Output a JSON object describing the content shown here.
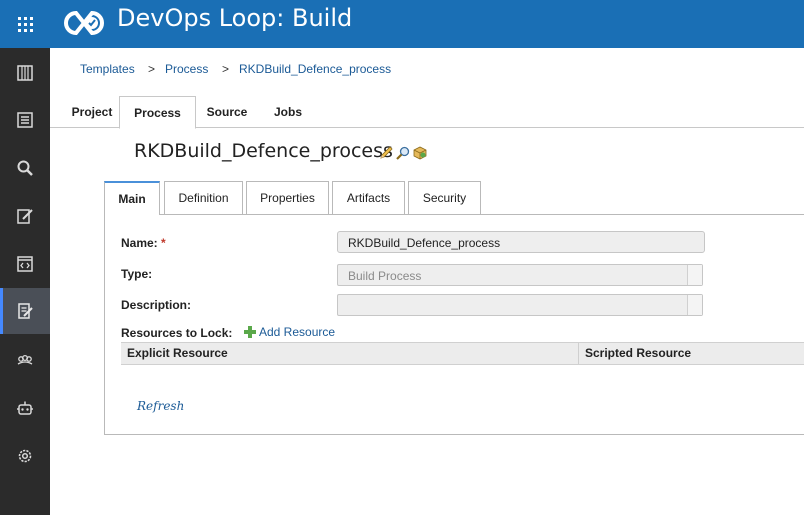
{
  "app": {
    "title": "DevOps Loop: Build",
    "brand_color": "#1a6fb5",
    "sidebar_color": "#2b2b2b",
    "grid_icon": "grid-icon",
    "logo_icon": "devops-loop-logo"
  },
  "sidebar": {
    "items": [
      {
        "name": "board",
        "icon": "board-icon",
        "active": false
      },
      {
        "name": "list",
        "icon": "list-icon",
        "active": false
      },
      {
        "name": "search",
        "icon": "search-icon",
        "active": false
      },
      {
        "name": "edit",
        "icon": "edit-icon",
        "active": false
      },
      {
        "name": "code",
        "icon": "code-icon",
        "active": false
      },
      {
        "name": "build",
        "icon": "build-process-icon",
        "active": true
      },
      {
        "name": "team",
        "icon": "team-icon",
        "active": false
      },
      {
        "name": "robot",
        "icon": "robot-icon",
        "active": false
      },
      {
        "name": "settings",
        "icon": "gear-icon",
        "active": false
      }
    ]
  },
  "breadcrumb": {
    "items": [
      "Templates",
      "Process",
      "RKDBuild_Defence_process"
    ],
    "separator": ">"
  },
  "top_tabs": {
    "items": [
      "Project",
      "Process",
      "Source",
      "Jobs"
    ],
    "active": "Process"
  },
  "page": {
    "title": "RKDBuild_Defence_process",
    "icons": [
      "pencil-icon",
      "magnifier-icon",
      "package-icon"
    ]
  },
  "inner_tabs": {
    "items": [
      "Main",
      "Definition",
      "Properties",
      "Artifacts",
      "Security"
    ],
    "active": "Main"
  },
  "form": {
    "name_label": "Name:",
    "required_mark": "*",
    "name_value": "RKDBuild_Defence_process",
    "type_label": "Type:",
    "type_value": "Build Process",
    "description_label": "Description:",
    "description_value": "",
    "resources_label": "Resources to Lock:",
    "add_resource_label": "Add Resource",
    "add_resource_icon": "plus-icon"
  },
  "resources_table": {
    "columns": [
      "Explicit Resource",
      "Scripted Resource"
    ],
    "rows": []
  },
  "refresh_label": "Refresh"
}
